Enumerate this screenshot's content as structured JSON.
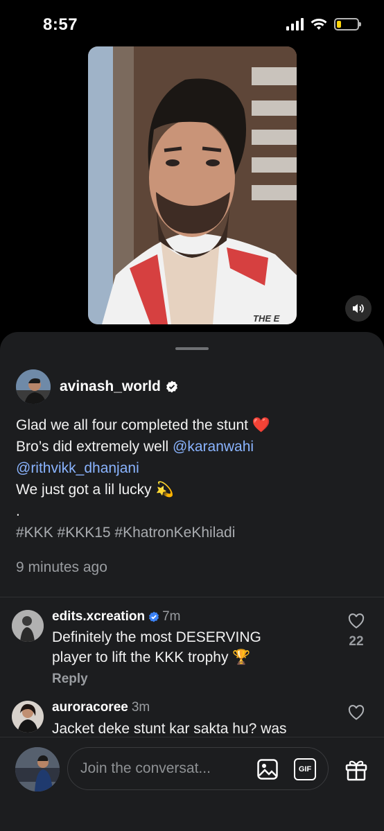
{
  "status_bar": {
    "time": "8:57",
    "battery_level": 0.2
  },
  "video": {
    "caption_overlay": "THE E"
  },
  "post": {
    "author": "avinash_world",
    "line1": "Glad we all four completed the stunt",
    "line1_emoji": "❤️",
    "line2_prefix": "Bro’s did extremely well",
    "mention1": "@karanwahi",
    "mention2": "@rithvikk_dhanjani",
    "line4": "We just got a lil lucky",
    "line4_emoji": "💫",
    "dot": ".",
    "hashtags": "#KKK #KKK15 #KhatronKeKhiladi",
    "time": "9 minutes ago"
  },
  "comments": [
    {
      "user": "edits.xcreation",
      "time": "7m",
      "line1": "Definitely the most DESERVING",
      "line2": "player to lift the KKK trophy",
      "emoji": "🏆",
      "reply_label": "Reply",
      "likes": "22"
    },
    {
      "user": "auroracoree",
      "time": "3m",
      "line1": "Jacket deke stunt kar sakta hu? was"
    }
  ],
  "composer": {
    "placeholder": "Join the conversat...",
    "gif_label": "GIF"
  }
}
